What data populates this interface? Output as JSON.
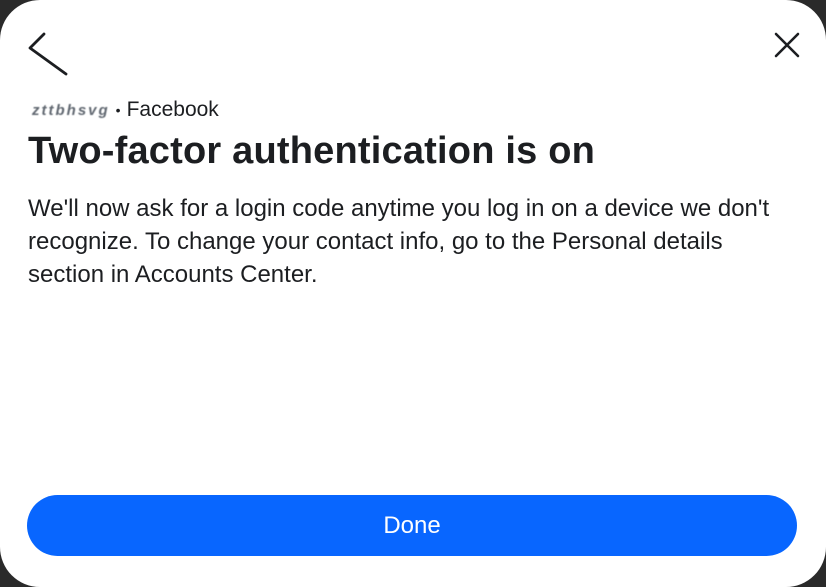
{
  "dialog": {
    "account_name": "zttbhsvg",
    "separator": "•",
    "platform": "Facebook",
    "title": "Two-factor authentication is on",
    "body": "We'll now ask for a login code anytime you log in on a device we don't recognize. To change your contact info, go to the Personal details section in Accounts Center.",
    "done_label": "Done",
    "back_icon": "chevron-left-icon",
    "close_icon": "close-icon"
  },
  "colors": {
    "primary_button": "#0866ff",
    "text": "#1c1e21",
    "background": "#ffffff"
  }
}
